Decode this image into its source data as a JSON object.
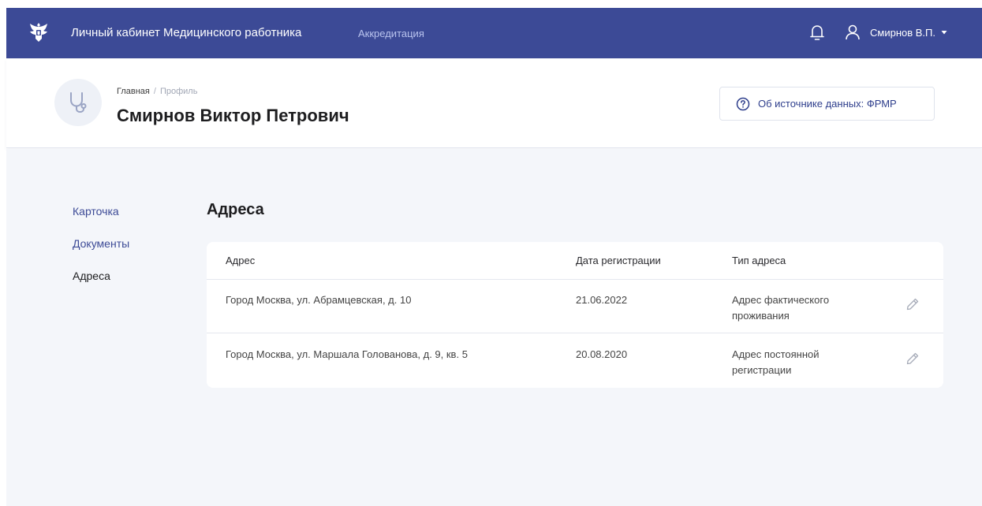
{
  "topbar": {
    "app_title": "Личный кабинет Медицинского работника",
    "accreditation_link": "Аккредитация",
    "user_name": "Смирнов В.П.",
    "icons": [
      "emblem-icon",
      "bell-icon",
      "user-icon",
      "caret-down-icon"
    ],
    "background": "#3c4a96"
  },
  "header": {
    "breadcrumb": {
      "home": "Главная",
      "separator": "/",
      "current": "Профиль"
    },
    "title": "Смирнов Виктор Петрович",
    "source_button": "Об источнике данных: ФРМР",
    "icons": [
      "stethoscope-icon",
      "question-circle-icon"
    ]
  },
  "sidebar": {
    "items": [
      {
        "label": "Карточка",
        "active": false
      },
      {
        "label": "Документы",
        "active": false
      },
      {
        "label": "Адреса",
        "active": true
      }
    ]
  },
  "addresses": {
    "title": "Адреса",
    "columns": [
      "Адрес",
      "Дата регистрации",
      "Тип адреса"
    ],
    "rows": [
      {
        "address": "Город Москва, ул. Абрамцевская, д. 10",
        "date": "21.06.2022",
        "type": "Адрес фактического проживания"
      },
      {
        "address": "Город Москва, ул. Маршала Голованова, д. 9, кв. 5",
        "date": "20.08.2020",
        "type": "Адрес постоянной регистрации"
      }
    ],
    "row_icon": "pencil-icon"
  },
  "colors": {
    "accent": "#3c4a96",
    "link": "#3c4a96",
    "page_background": "#f4f6fa"
  }
}
